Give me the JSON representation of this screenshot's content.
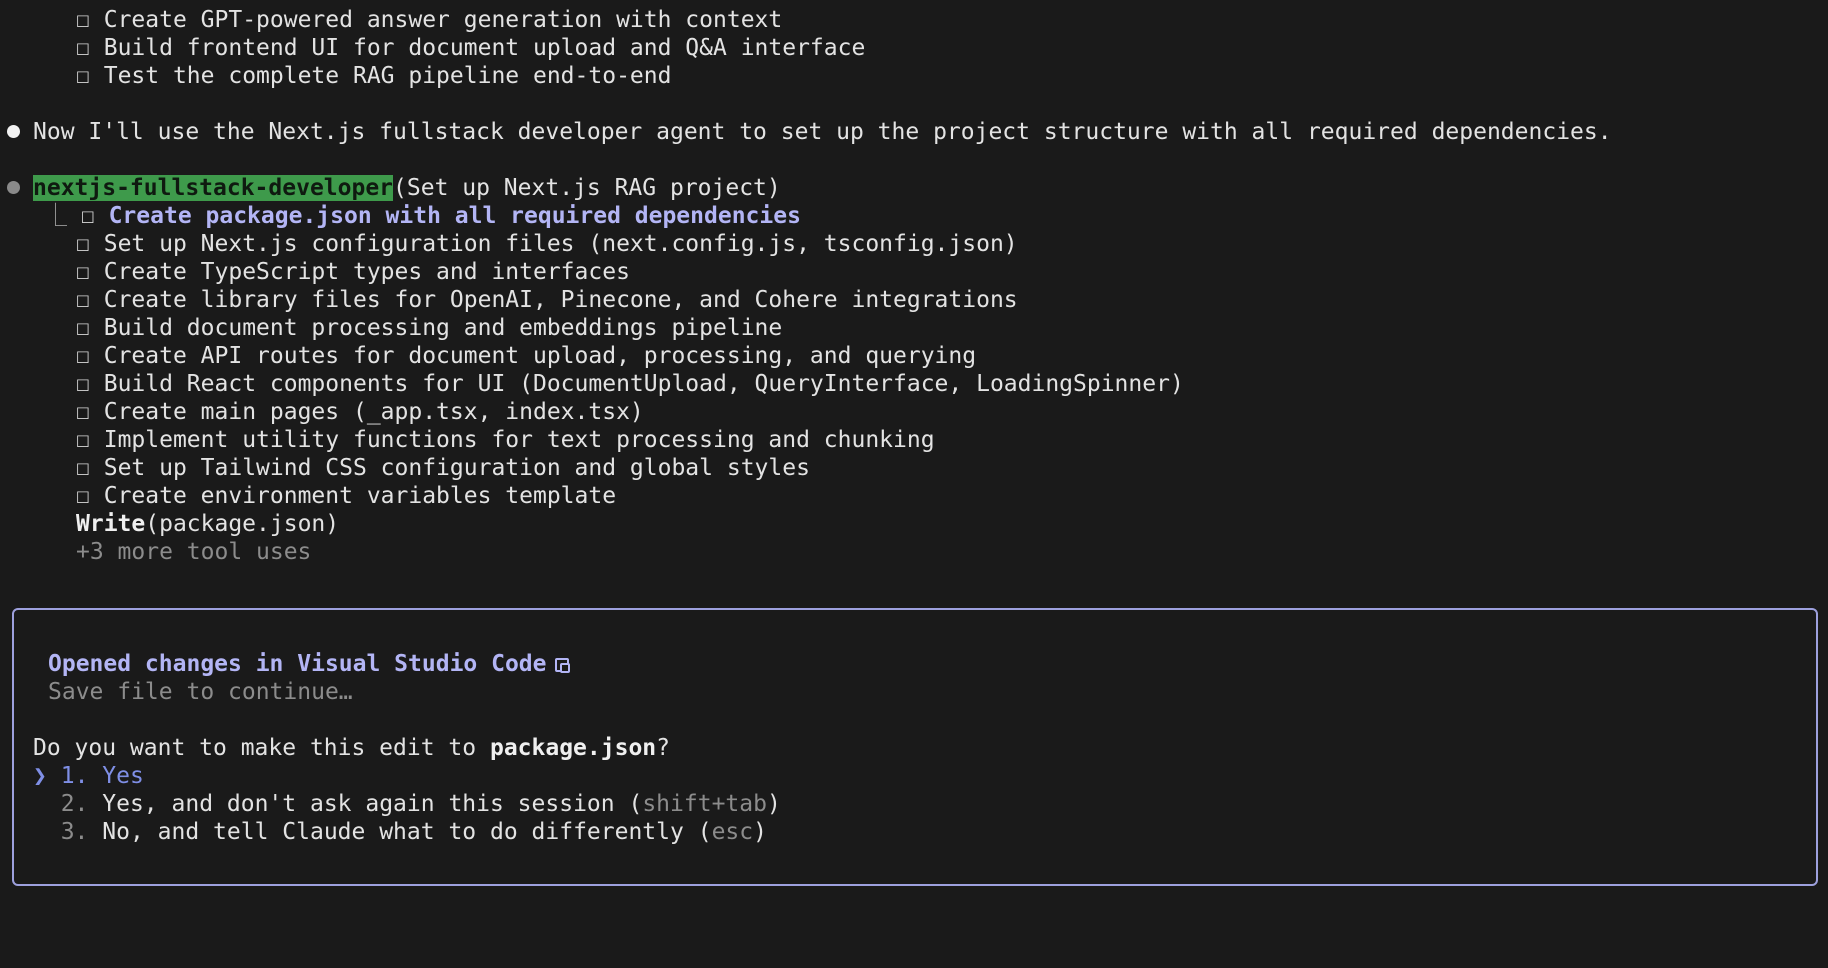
{
  "checkbox_glyph": "☐",
  "top_tasks": [
    "Create GPT-powered answer generation with context",
    "Build frontend UI for document upload and Q&A interface",
    "Test the complete RAG pipeline end-to-end"
  ],
  "assistant_message": "Now I'll use the Next.js fullstack developer agent to set up the project structure with all required dependencies.",
  "agent": {
    "name": "nextjs-fullstack-developer",
    "task": "(Set up Next.js RAG project)",
    "tree_branch": "⎿",
    "active_task": "Create package.json with all required dependencies",
    "tasks": [
      "Set up Next.js configuration files (next.config.js, tsconfig.json)",
      "Create TypeScript types and interfaces",
      "Create library files for OpenAI, Pinecone, and Cohere integrations",
      "Build document processing and embeddings pipeline",
      "Create API routes for document upload, processing, and querying",
      "Build React components for UI (DocumentUpload, QueryInterface, LoadingSpinner)",
      "Create main pages (_app.tsx, index.tsx)",
      "Implement utility functions for text processing and chunking",
      "Set up Tailwind CSS configuration and global styles",
      "Create environment variables template"
    ],
    "tool_name": "Write",
    "tool_arg": "(package.json)",
    "more_tools": "+3 more tool uses"
  },
  "dialog": {
    "title": "Opened changes in Visual Studio Code",
    "subtitle": "Save file to continue…",
    "question_prefix": "Do you want to make this edit to ",
    "question_file": "package.json",
    "question_suffix": "?",
    "pointer": "❯",
    "options": [
      {
        "num": "1.",
        "label": "Yes",
        "hint_open": "",
        "hint": "",
        "hint_close": ""
      },
      {
        "num": "2.",
        "label": "Yes, and don't ask again this session ",
        "hint_open": "(",
        "hint": "shift+tab",
        "hint_close": ")"
      },
      {
        "num": "3.",
        "label": "No, and tell Claude what to do differently ",
        "hint_open": "(",
        "hint": "esc",
        "hint_close": ")"
      }
    ]
  }
}
